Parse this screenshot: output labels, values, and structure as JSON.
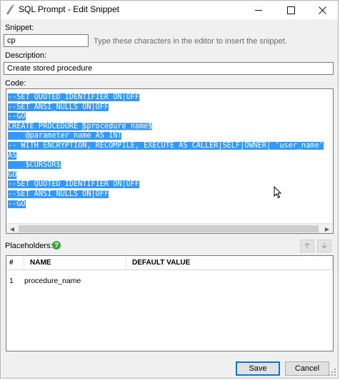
{
  "window": {
    "title": "SQL Prompt - Edit Snippet"
  },
  "snippet": {
    "label": "Snippet:",
    "value": "cp",
    "hint": "Type these characters in the editor to insert the snippet."
  },
  "description": {
    "label": "Description:",
    "value": "Create stored procedure"
  },
  "code": {
    "label": "Code:",
    "lines": [
      "--SET QUOTED_IDENTIFIER ON|OFF",
      "--SET ANSI_NULLS ON|OFF",
      "--GO",
      "CREATE PROCEDURE ",
      "    @parameter_name AS INT",
      "-- WITH ENCRYPTION, RECOMPILE, EXECUTE AS CALLER|SELF|OWNER| 'user_name'",
      "AS",
      "    $CURSOR$",
      "GO",
      "--SET QUOTED_IDENTIFIER ON|OFF",
      "--SET ANSI_NULLS ON|OFF",
      "--GO"
    ],
    "placeholder_token": "$procedure_name$"
  },
  "placeholders": {
    "label": "Placeholders:",
    "columns": [
      "#",
      "NAME",
      "DEFAULT VALUE"
    ],
    "rows": [
      {
        "index": "1",
        "name": "procedure_name",
        "default": ""
      }
    ]
  },
  "buttons": {
    "save": "Save",
    "cancel": "Cancel"
  },
  "icons": {
    "app": "sql-prompt-icon",
    "help": "help-icon",
    "up": "arrow-up-icon",
    "down": "arrow-down-icon"
  },
  "colors": {
    "selection": "#3399ff",
    "primary_border": "#0078d7",
    "help_green": "#3aa53a"
  }
}
